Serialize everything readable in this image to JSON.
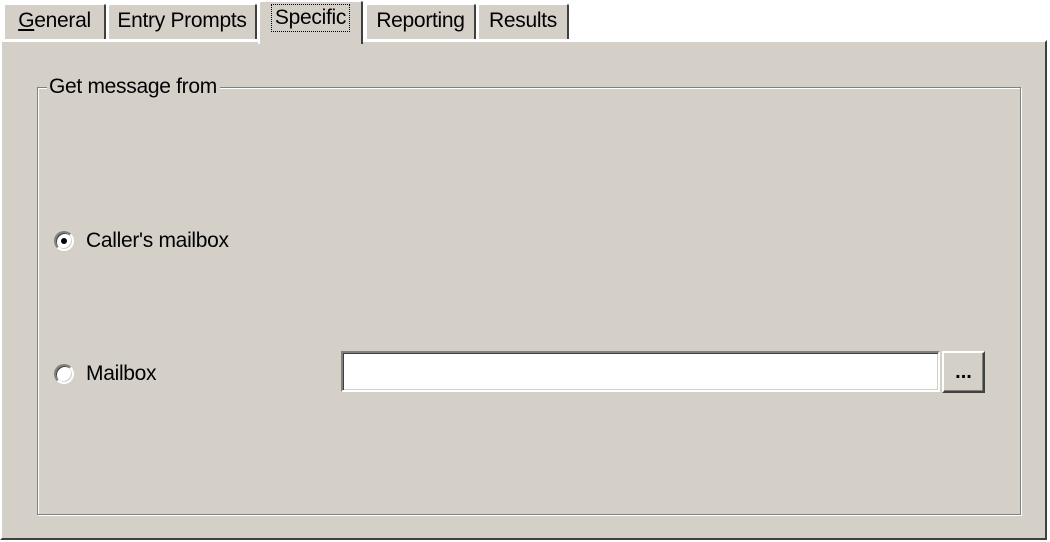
{
  "tabs": [
    {
      "label_underlined": "G",
      "label_rest": "eneral",
      "active": false
    },
    {
      "label": "Entry Prompts",
      "active": false
    },
    {
      "label": "Specific",
      "active": true
    },
    {
      "label": "Reporting",
      "active": false
    },
    {
      "label": "Results",
      "active": false
    }
  ],
  "group": {
    "title": "Get message from",
    "options": [
      {
        "label": "Caller's mailbox",
        "selected": true
      },
      {
        "label": "Mailbox",
        "selected": false
      }
    ]
  },
  "mailbox_field": {
    "value": "",
    "placeholder": ""
  },
  "browse_button": {
    "label": "..."
  },
  "colors": {
    "dialog_face": "#d4d0c8",
    "highlight": "#ffffff",
    "shadow": "#808080",
    "dark_shadow": "#404040"
  }
}
